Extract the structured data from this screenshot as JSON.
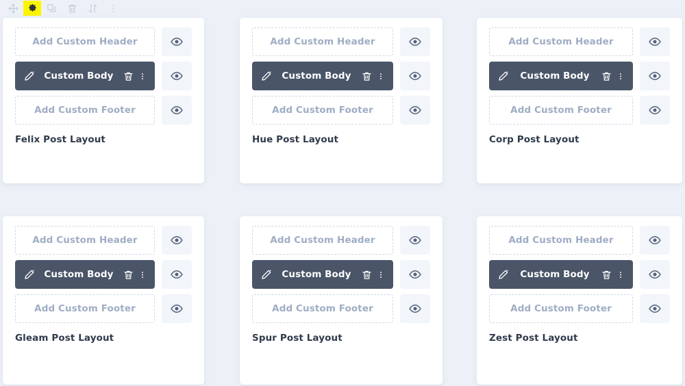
{
  "toolbar": {
    "items": [
      {
        "name": "move-icon",
        "label": "Move",
        "highlighted": false
      },
      {
        "name": "gear-icon",
        "label": "Settings",
        "highlighted": true
      },
      {
        "name": "duplicate-icon",
        "label": "Duplicate",
        "highlighted": false
      },
      {
        "name": "trash-icon",
        "label": "Delete",
        "highlighted": false
      },
      {
        "name": "sort-icon",
        "label": "Sort",
        "highlighted": false
      },
      {
        "name": "more-icon",
        "label": "More",
        "highlighted": false
      }
    ],
    "highlight_color": "#fbf500"
  },
  "labels": {
    "add_custom_header": "Add Custom Header",
    "add_custom_footer": "Add Custom Footer",
    "custom_body": "Custom Body"
  },
  "colors": {
    "page_background": "#edf1f7",
    "card_background": "#ffffff",
    "filled_slot": "#4a5568",
    "placeholder_text": "#9fadc4",
    "placeholder_border": "#ccd8e8",
    "eye_button_background": "#f2f5fa",
    "title_text": "#2f3a4a"
  },
  "cards": [
    {
      "title": "Felix Post Layout",
      "header": {
        "label": "Add Custom Header",
        "state": "empty"
      },
      "body": {
        "label": "Custom Body",
        "state": "filled"
      },
      "footer": {
        "label": "Add Custom Footer",
        "state": "empty"
      }
    },
    {
      "title": "Hue Post Layout",
      "header": {
        "label": "Add Custom Header",
        "state": "empty"
      },
      "body": {
        "label": "Custom Body",
        "state": "filled"
      },
      "footer": {
        "label": "Add Custom Footer",
        "state": "empty"
      }
    },
    {
      "title": "Corp Post Layout",
      "header": {
        "label": "Add Custom Header",
        "state": "empty"
      },
      "body": {
        "label": "Custom Body",
        "state": "filled"
      },
      "footer": {
        "label": "Add Custom Footer",
        "state": "empty"
      }
    },
    {
      "title": "Gleam Post Layout",
      "header": {
        "label": "Add Custom Header",
        "state": "empty"
      },
      "body": {
        "label": "Custom Body",
        "state": "filled"
      },
      "footer": {
        "label": "Add Custom Footer",
        "state": "empty"
      }
    },
    {
      "title": "Spur Post Layout",
      "header": {
        "label": "Add Custom Header",
        "state": "empty"
      },
      "body": {
        "label": "Custom Body",
        "state": "filled"
      },
      "footer": {
        "label": "Add Custom Footer",
        "state": "empty"
      }
    },
    {
      "title": "Zest Post Layout",
      "header": {
        "label": "Add Custom Header",
        "state": "empty"
      },
      "body": {
        "label": "Custom Body",
        "state": "filled"
      },
      "footer": {
        "label": "Add Custom Footer",
        "state": "empty"
      }
    }
  ]
}
